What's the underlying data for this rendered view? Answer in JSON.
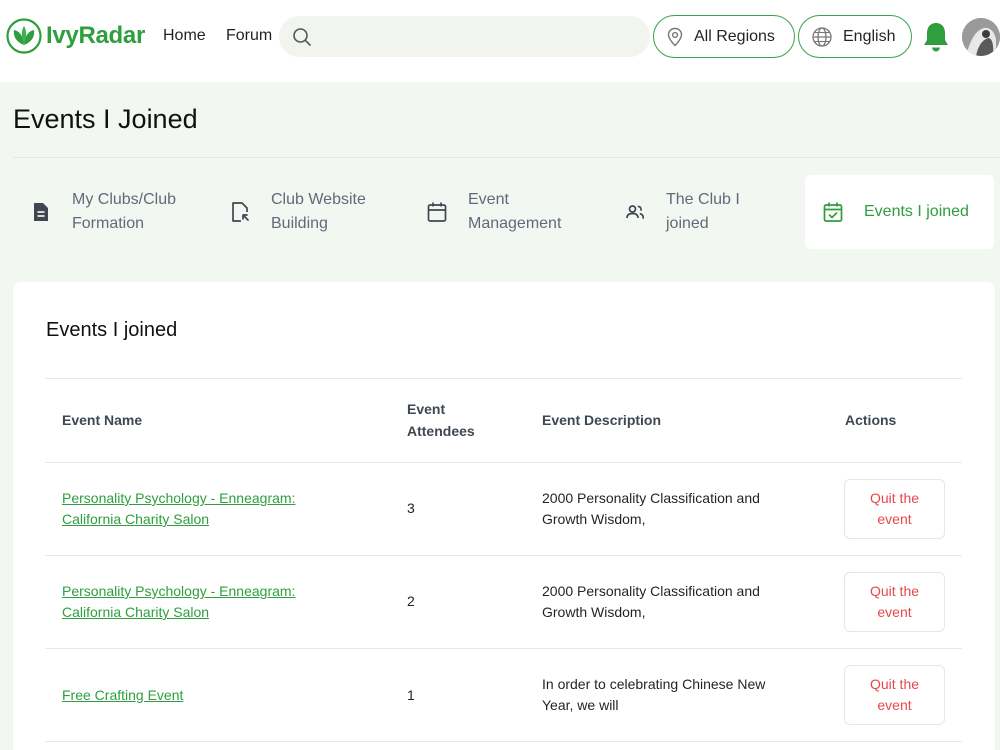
{
  "header": {
    "brand": "IvyRadar",
    "nav": {
      "home": "Home",
      "forum": "Forum"
    },
    "search": {
      "placeholder": ""
    },
    "region": "All Regions",
    "language": "English",
    "brand_color": "#2e9e3e"
  },
  "page": {
    "title": "Events I Joined"
  },
  "tabs": [
    {
      "line1": "My Clubs/Club",
      "line2": "Formation",
      "icon": "document-icon"
    },
    {
      "line1": "Club Website",
      "line2": "Building",
      "icon": "file-edit-icon"
    },
    {
      "line1": "Event",
      "line2": "Management",
      "icon": "calendar-icon"
    },
    {
      "line1": "The Club I",
      "line2": "joined",
      "icon": "users-icon"
    },
    {
      "line1": "Events I joined",
      "line2": "",
      "icon": "calendar-check-icon",
      "active": true
    }
  ],
  "card": {
    "title": "Events I joined",
    "columns": {
      "name": "Event Name",
      "attendees_line1": "Event",
      "attendees_line2": "Attendees",
      "description": "Event Description",
      "actions": "Actions"
    },
    "rows": [
      {
        "name_line1": "Personality Psychology - Enneagram:",
        "name_line2": "California Charity Salon",
        "attendees": "3",
        "desc_line1": "2000 Personality Classification and",
        "desc_line2": "Growth Wisdom,",
        "action_line1": "Quit the",
        "action_line2": "event"
      },
      {
        "name_line1": "Personality Psychology - Enneagram:",
        "name_line2": "California Charity Salon",
        "attendees": "2",
        "desc_line1": "2000 Personality Classification and",
        "desc_line2": "Growth Wisdom,",
        "action_line1": "Quit the",
        "action_line2": "event"
      },
      {
        "name_line1": "Free Crafting Event",
        "name_line2": "",
        "attendees": "1",
        "desc_line1": "In order to celebrating Chinese New",
        "desc_line2": "Year, we will",
        "action_line1": "Quit the",
        "action_line2": "event"
      }
    ]
  }
}
